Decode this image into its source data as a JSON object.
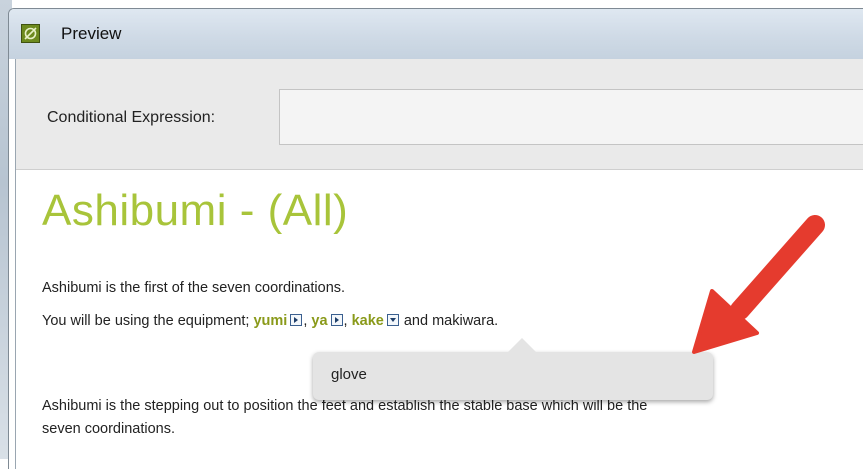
{
  "window": {
    "title": "Preview",
    "app_icon": "preview-app-icon"
  },
  "condition": {
    "label": "Conditional Expression:",
    "value": ""
  },
  "content": {
    "heading": "Ashibumi - (All)",
    "line1": "Ashibumi is the first of the seven coordinations.",
    "line2_prefix": "You will be using the equipment; ",
    "keyword1": "yumi",
    "sep1": ", ",
    "keyword2": "ya",
    "sep2": ", ",
    "keyword3": "kake",
    "line2_suffix": " and makiwara.",
    "line3": "Ashibumi is the stepping out to position the feet and establish the stable base which will be the",
    "line4": "seven coordinations."
  },
  "popup": {
    "item": "glove"
  },
  "colors": {
    "heading": "#a8c43a",
    "keyword": "#8a9a1a",
    "annotation_arrow": "#e53b2e"
  }
}
